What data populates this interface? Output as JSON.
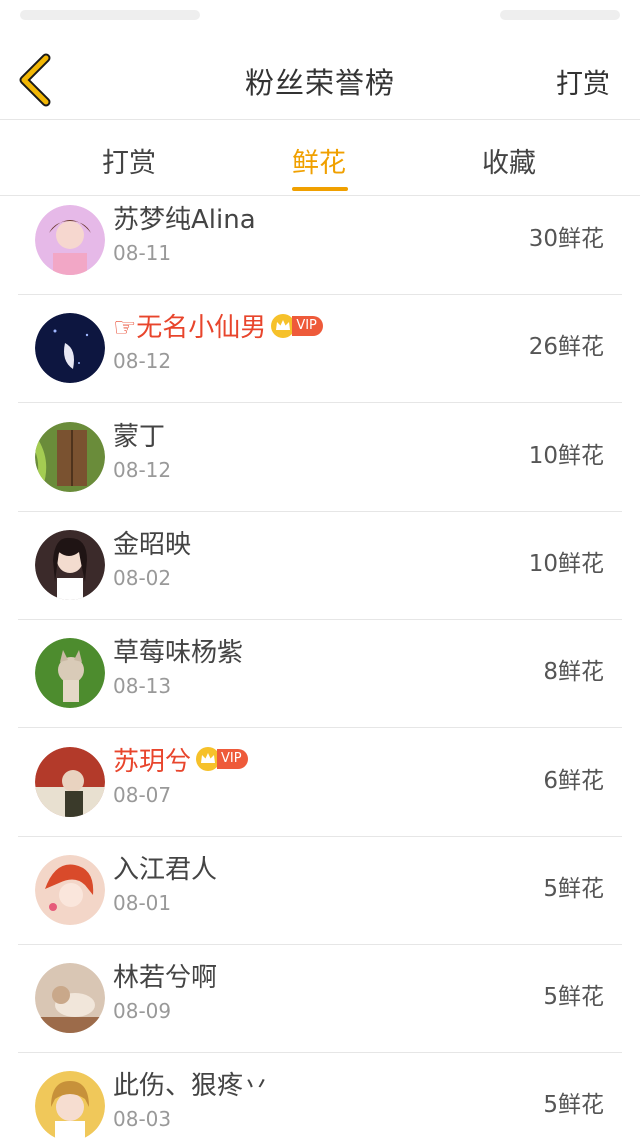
{
  "header": {
    "title": "粉丝荣誉榜",
    "action_label": "打赏"
  },
  "tabs": [
    {
      "label": "打赏",
      "active": false
    },
    {
      "label": "鲜花",
      "active": true
    },
    {
      "label": "收藏",
      "active": false
    }
  ],
  "colors": {
    "accent": "#f0a000",
    "vip_name": "#e8452c",
    "vip_badge": "#ee5a3a",
    "secondary_text": "#999999"
  },
  "fans": [
    {
      "name": "苏梦纯Alina",
      "date": "08-11",
      "amount": "30鲜花",
      "vip": false
    },
    {
      "name": "☞无名小仙男",
      "date": "08-12",
      "amount": "26鲜花",
      "vip": true,
      "vip_label": "VIP"
    },
    {
      "name": "蒙丁",
      "date": "08-12",
      "amount": "10鲜花",
      "vip": false
    },
    {
      "name": "金昭映",
      "date": "08-02",
      "amount": "10鲜花",
      "vip": false
    },
    {
      "name": "草莓味杨紫",
      "date": "08-13",
      "amount": "8鲜花",
      "vip": false
    },
    {
      "name": "苏玥兮",
      "date": "08-07",
      "amount": "6鲜花",
      "vip": true,
      "vip_label": "VIP"
    },
    {
      "name": "入江君人",
      "date": "08-01",
      "amount": "5鲜花",
      "vip": false
    },
    {
      "name": "林若兮啊",
      "date": "08-09",
      "amount": "5鲜花",
      "vip": false
    },
    {
      "name": "此伤、狠疼丷",
      "date": "08-03",
      "amount": "5鲜花",
      "vip": false
    }
  ]
}
